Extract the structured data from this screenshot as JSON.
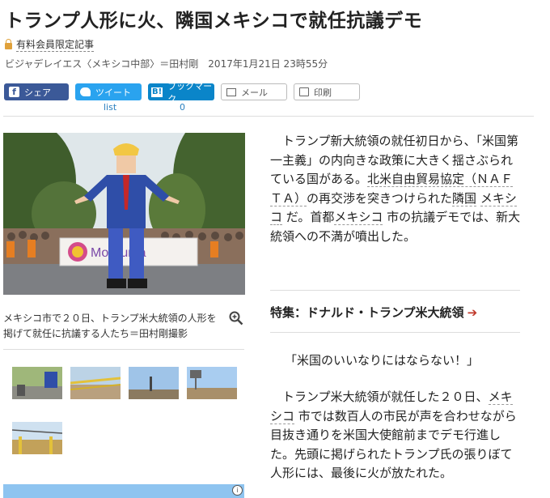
{
  "article": {
    "title": "トランプ人形に火、隣国メキシコで就任抗議デモ",
    "member_label": "有料会員限定記事",
    "byline": "ビジャデレイエス〈メキシコ中部〉＝田村剛",
    "date": "2017年1月21日 23時55分"
  },
  "share": {
    "facebook": "シェア",
    "twitter": "ツイート",
    "twitter_count": "list",
    "hatena_icon": "B!",
    "hatena": "ブックマーク",
    "hatena_count": "0",
    "mail": "メール",
    "print": "印刷"
  },
  "photo": {
    "sign_text": "Mo Suma",
    "caption": "メキシコ市で２０日、トランプ米大統領の人形を掲げて就任に抗議する人たち＝田村剛撮影"
  },
  "body": {
    "p1_a": "トランプ新大統領の就任初日から、「米国第一主義」の内向きな政策に大きく揺さぶられている国がある。",
    "p1_k1": "北米自由貿易協定（ＮＡＦＴＡ）",
    "p1_b": "の再交渉を突きつけられた",
    "p1_k2": "隣国",
    "p1_k3": "メキシコ",
    "p1_c": "だ。首都",
    "p1_k4": "メキシコ",
    "p1_d": "市の抗議デモでは、新大統領への不満が噴出した。",
    "special_label": "特集：ドナルド・トランプ米大統領",
    "quote": "「米国のいいなりにはならない！」",
    "p2_a": "トランプ米大統領が就任した２０日、",
    "p2_k1": "メキシコ",
    "p2_b": "市では数百人の市民が声を合わせながら目抜き通りを米国大使館前までデモ行進した。先頭に掲げられたトランプ氏の張りぼて人形には、最後に火が放たれた。"
  },
  "colors": {
    "facebook": "#3b5998",
    "twitter": "#2aa3ef",
    "hatena": "#0a85c9",
    "accent_arrow": "#c0392b",
    "lock": "#e0a13a"
  }
}
